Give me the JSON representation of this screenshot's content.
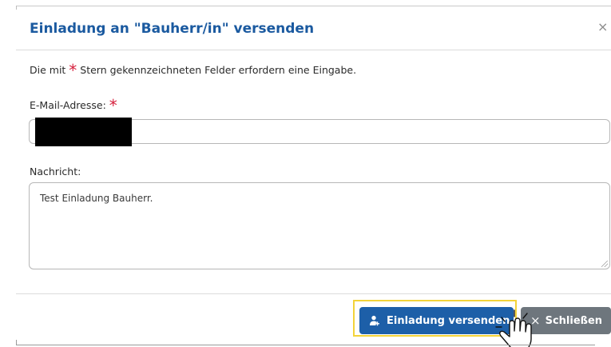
{
  "dialog": {
    "title": "Einladung an \"Bauherr/in\" versenden",
    "close_symbol": "×"
  },
  "form": {
    "intro_prefix": "Die mit ",
    "required_marker": "*",
    "intro_suffix": " Stern gekennzeichneten Felder erfordern eine Eingabe.",
    "email_label": "E-Mail-Adresse:",
    "email_value": "",
    "message_label": "Nachricht:",
    "message_value": "Test Einladung Bauherr."
  },
  "footer": {
    "send_label": "Einladung versenden",
    "send_icon": "user-plus-icon",
    "close_label": "Schließen",
    "close_icon": "close-icon"
  },
  "colors": {
    "title": "#1b5aa0",
    "required": "#d6213d",
    "primary_button": "#1d5fa8",
    "secondary_button": "#6e767d",
    "highlight": "#f3d33a"
  }
}
